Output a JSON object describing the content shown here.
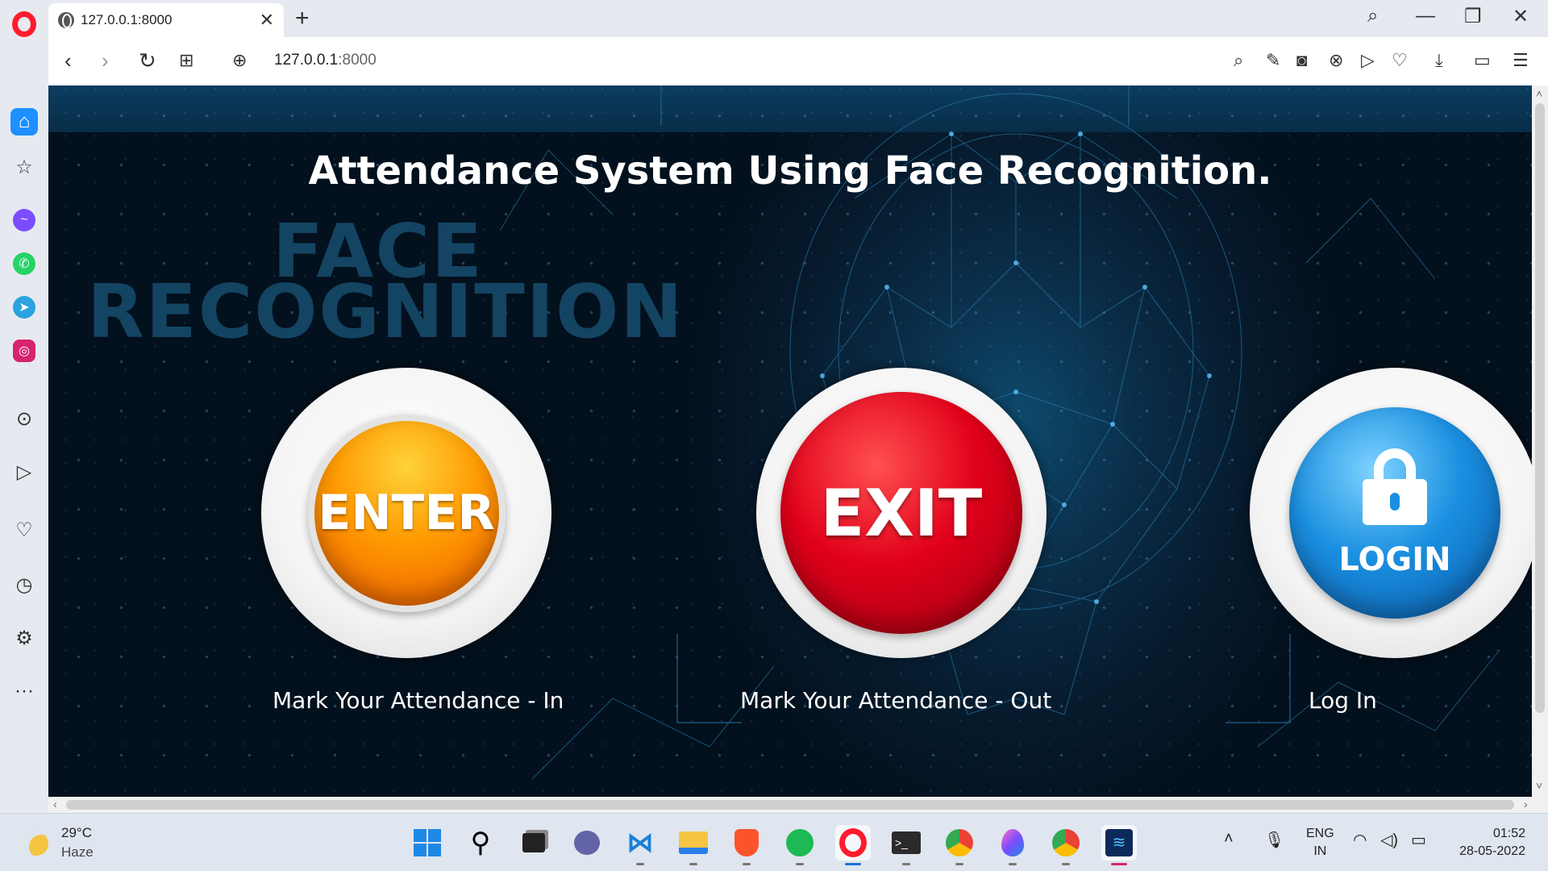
{
  "browser": {
    "tab_title": "127.0.0.1:8000",
    "url_host": "127.0.0.1",
    "url_port": ":8000"
  },
  "page": {
    "title": "Attendance System Using Face Recognition.",
    "bg_word_1": "FACE",
    "bg_word_2": "RECOGNITION",
    "buttons": [
      {
        "image_text": "ENTER",
        "caption": "Mark Your Attendance - In"
      },
      {
        "image_text": "EXIT",
        "caption": "Mark Your Attendance - Out"
      },
      {
        "image_text": "LOGIN",
        "caption": "Log In"
      }
    ]
  },
  "taskbar": {
    "weather_temp": "29°C",
    "weather_desc": "Haze",
    "lang_line1": "ENG",
    "lang_line2": "IN",
    "time": "01:52",
    "date": "28-05-2022"
  },
  "colors": {
    "opera_red": "#ff1b2d",
    "enter_orange": "#ff9a00",
    "exit_red": "#e1001a",
    "login_blue": "#1a8fe0",
    "page_bg": "#061a2c"
  }
}
